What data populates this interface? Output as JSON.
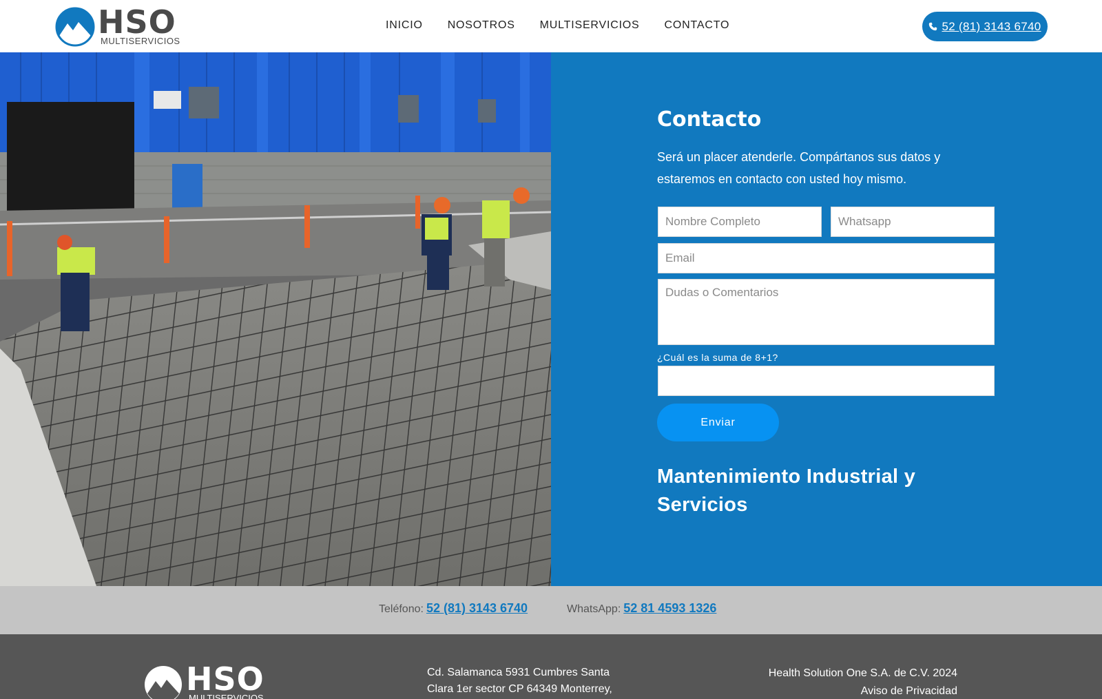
{
  "colors": {
    "primary_blue": "#1179bf",
    "button_blue": "#0792f2",
    "strip_gray": "#c4c4c4",
    "footer_gray": "#565656"
  },
  "header": {
    "logo_brand": "HSO",
    "logo_sub": "MULTISERVICIOS",
    "nav": [
      "INICIO",
      "NOSOTROS",
      "MULTISERVICIOS",
      "CONTACTO"
    ],
    "phone_icon": "phone-icon",
    "phone_label": "52 (81) 3143 6740"
  },
  "contact": {
    "title": "Contacto",
    "intro": "Será un placer atenderle. Compártanos sus datos y estaremos en contacto con usted hoy mismo.",
    "name_placeholder": "Nombre Completo",
    "whatsapp_placeholder": "Whatsapp",
    "email_placeholder": "Email",
    "message_placeholder": "Dudas o Comentarios",
    "captcha_label": "¿Cuál es la suma de 8+1?",
    "captcha_value": "",
    "submit_label": "Enviar",
    "tagline": "Mantenimiento Industrial y Servicios"
  },
  "strip": {
    "phone_label": "Teléfono:",
    "phone_value": "52 (81) 3143 6740",
    "whatsapp_label": "WhatsApp:",
    "whatsapp_value": "52 81 4593 1326"
  },
  "footer": {
    "logo_brand": "HSO",
    "logo_sub": "MULTISERVICIOS",
    "address": "Cd. Salamanca 5931 Cumbres Santa Clara 1er sector CP 64349 Monterrey,",
    "company": "Health Solution One S.A. de C.V. 2024",
    "privacy_link": "Aviso de Privacidad"
  }
}
